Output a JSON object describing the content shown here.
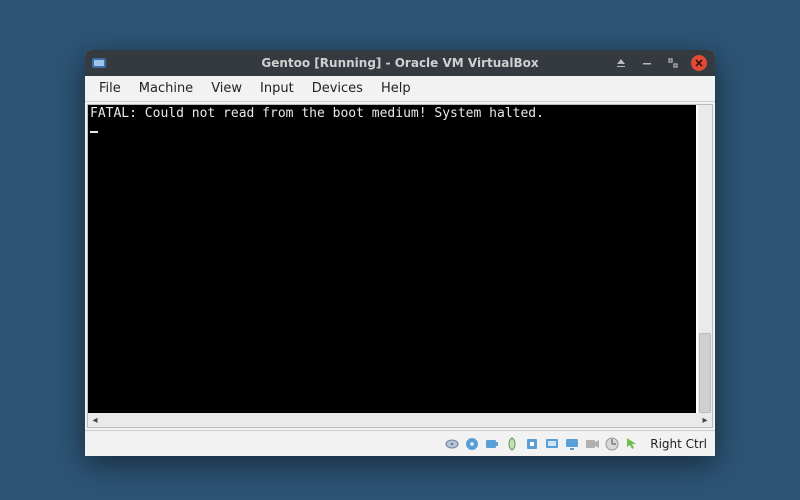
{
  "titlebar": {
    "title": "Gentoo [Running] - Oracle VM VirtualBox"
  },
  "menubar": {
    "items": [
      "File",
      "Machine",
      "View",
      "Input",
      "Devices",
      "Help"
    ]
  },
  "console": {
    "line1": "FATAL: Could not read from the boot medium! System halted."
  },
  "statusbar": {
    "hostkey_label": "Right Ctrl",
    "icons": [
      "harddisk-icon",
      "optical-disc-icon",
      "audio-icon",
      "network-icon",
      "usb-icon",
      "shared-folder-icon",
      "display-icon",
      "recording-icon",
      "cpu-icon",
      "mouse-integration-icon"
    ]
  }
}
